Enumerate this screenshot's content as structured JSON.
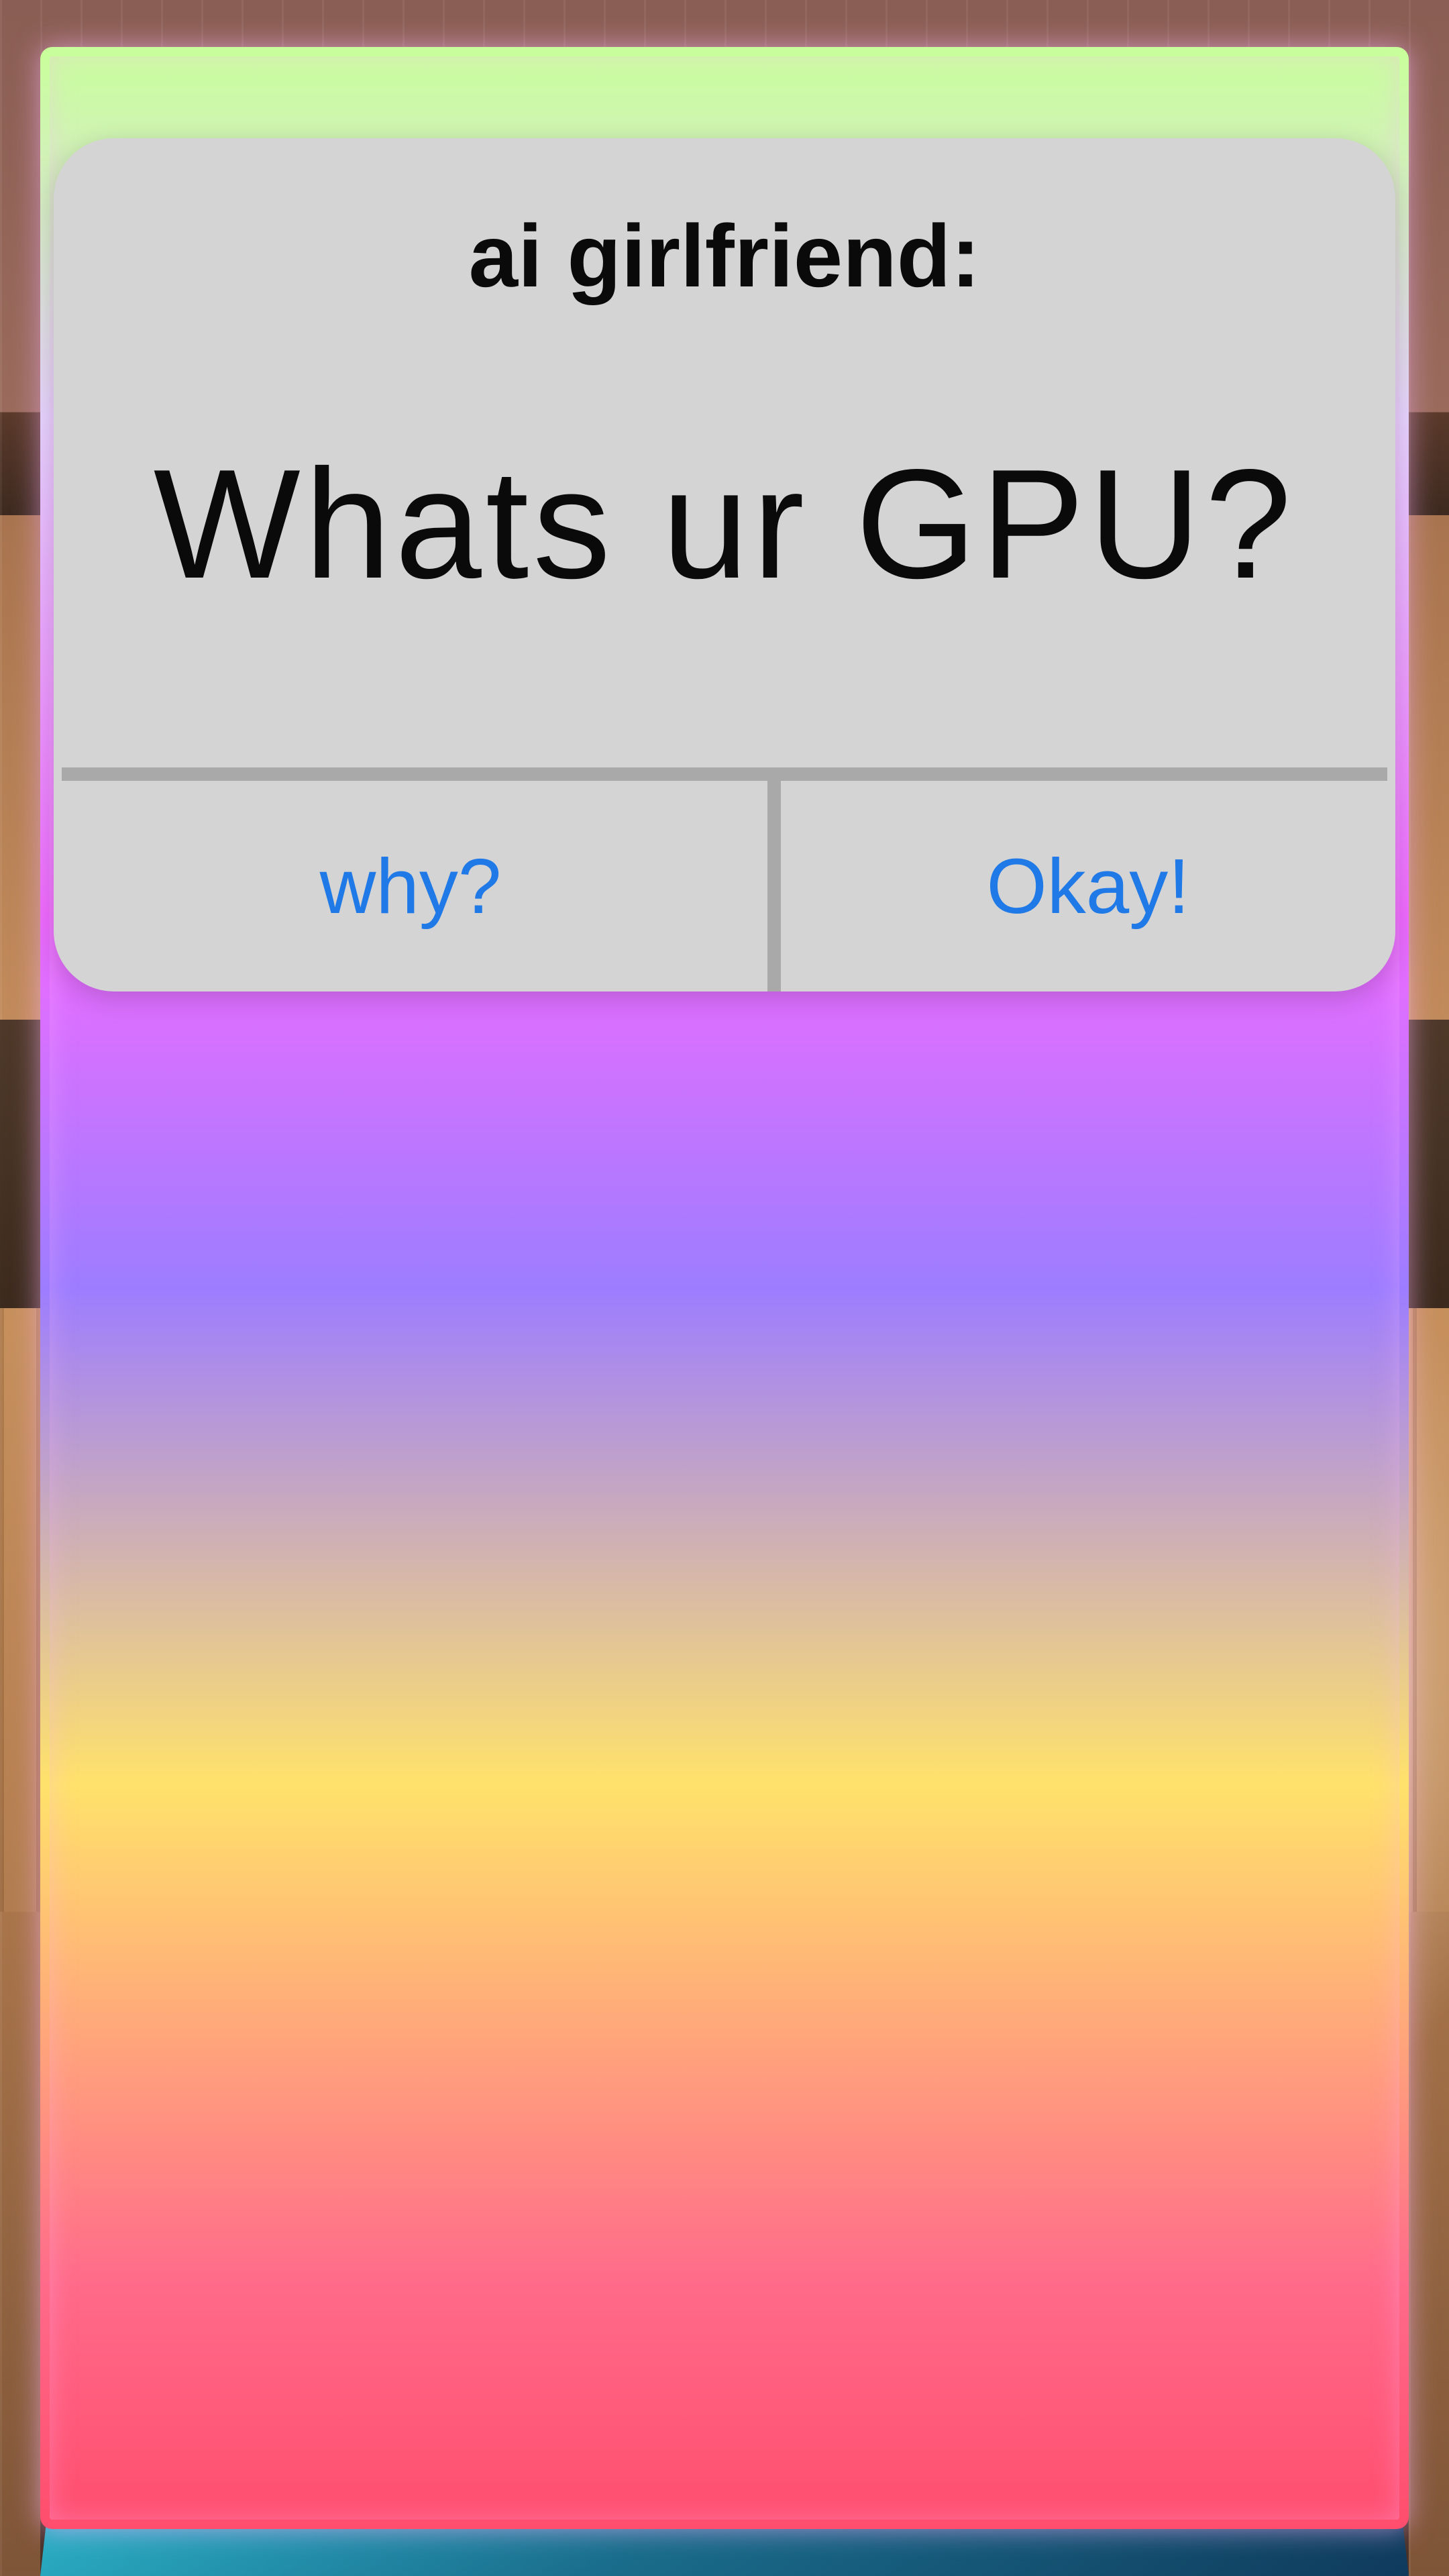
{
  "dialog": {
    "title": "ai girlfriend:",
    "message": "Whats ur GPU?",
    "buttons": {
      "left_label": "why?",
      "right_label": "Okay!"
    }
  },
  "colors": {
    "dialog_background": "#d4d4d4",
    "divider": "#a9a9a9",
    "button_text": "#1f79e6",
    "text": "#0a0a0a",
    "neon_border_top": "#e8d2ff",
    "neon_border_middle": "#f06bff",
    "neon_border_bottom": "#ff4d6d"
  }
}
